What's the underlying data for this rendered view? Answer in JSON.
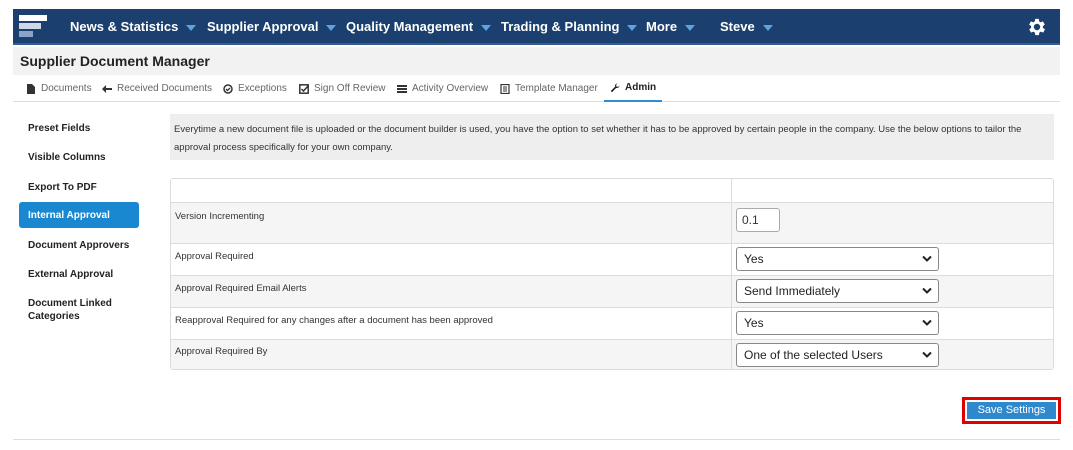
{
  "nav": {
    "items": [
      {
        "label": "News & Statistics"
      },
      {
        "label": "Supplier Approval"
      },
      {
        "label": "Quality Management"
      },
      {
        "label": "Trading & Planning"
      },
      {
        "label": "More"
      },
      {
        "label": "Steve"
      }
    ],
    "settings_icon": "gear-icon",
    "logo_icon": "app-logo"
  },
  "page": {
    "title": "Supplier Document Manager"
  },
  "tabs": [
    {
      "label": "Documents",
      "icon": "file-icon"
    },
    {
      "label": "Received Documents",
      "icon": "arrow-left-icon"
    },
    {
      "label": "Exceptions",
      "icon": "check-circle-icon"
    },
    {
      "label": "Sign Off Review",
      "icon": "check-square-icon"
    },
    {
      "label": "Activity Overview",
      "icon": "list-icon"
    },
    {
      "label": "Template Manager",
      "icon": "document-icon"
    },
    {
      "label": "Admin",
      "icon": "wrench-icon",
      "active": true
    }
  ],
  "sidebar": {
    "items": [
      {
        "label": "Preset Fields"
      },
      {
        "label": "Visible Columns"
      },
      {
        "label": "Export To PDF"
      },
      {
        "label": "Internal Approval",
        "active": true
      },
      {
        "label": "Document Approvers"
      },
      {
        "label": "External Approval"
      },
      {
        "label": "Document Linked Categories"
      }
    ]
  },
  "info": {
    "text": "Everytime a new document file is uploaded or the document builder is used, you have the option to set whether it has to be approved by certain people in the company. Use the below options to tailor the approval process specifically for your own company."
  },
  "settings": {
    "version": {
      "label": "Version Incrementing",
      "value": "0.1"
    },
    "approval_required": {
      "label": "Approval Required",
      "value": "Yes"
    },
    "email_alerts": {
      "label": "Approval Required Email Alerts",
      "value": "Send Immediately"
    },
    "reapproval": {
      "label": "Reapproval Required for any changes after a document has been approved",
      "value": "Yes"
    },
    "approval_by": {
      "label": "Approval Required By",
      "value": "One of the selected Users"
    }
  },
  "actions": {
    "save_label": "Save Settings"
  },
  "colors": {
    "nav_bg": "#1b3f6f",
    "accent": "#1a87d1",
    "highlight": "#e00000"
  }
}
